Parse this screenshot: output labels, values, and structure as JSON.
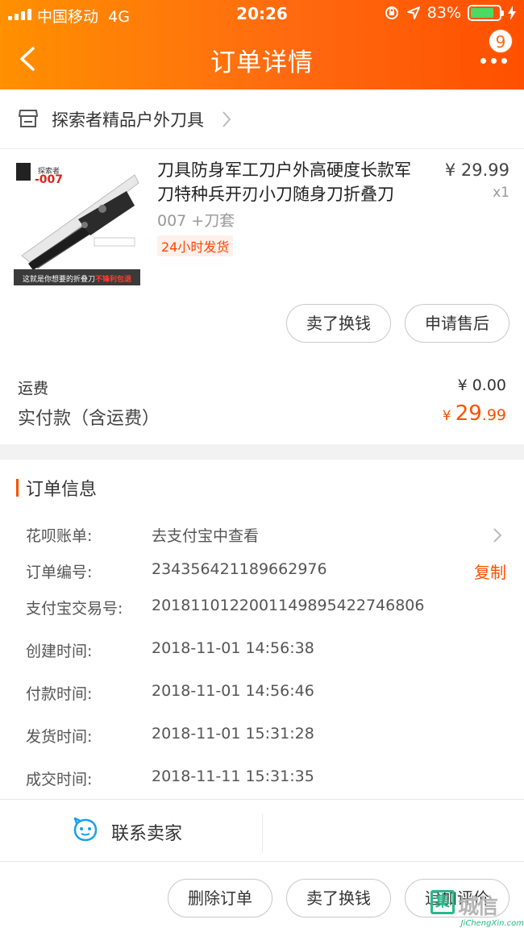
{
  "status_bar": {
    "carrier": "中国移动",
    "network": "4G",
    "time": "20:26",
    "battery_percent": "83%",
    "battery_level": 0.83
  },
  "nav": {
    "title": "订单详情",
    "badge": "9"
  },
  "shop": {
    "name": "探索者精品户外刀具"
  },
  "product": {
    "image": {
      "brand_label": "探索者",
      "model": "-007",
      "banner_prefix": "这就是你想要的折叠刀",
      "banner_highlight": "不锋利包退"
    },
    "title": "刀具防身军工刀户外高硬度长款军刀特种兵开刃小刀随身刀折叠刀",
    "price": "¥ 29.99",
    "quantity": "x1",
    "sku": "007 +刀套",
    "tag": "24小时发货"
  },
  "item_actions": {
    "resell": "卖了换钱",
    "after_sale": "申请售后"
  },
  "summary": {
    "shipping_label": "运费",
    "shipping_value": "¥ 0.00",
    "paid_label": "实付款（含运费）",
    "paid_currency": "¥",
    "paid_int": "29",
    "paid_dec": ".99"
  },
  "order_info": {
    "section_title": "订单信息",
    "huabei_label": "花呗账单:",
    "huabei_value": "去支付宝中查看",
    "order_no_label": "订单编号:",
    "order_no_value": "234356421189662976",
    "copy_label": "复制",
    "alipay_no_label": "支付宝交易号:",
    "alipay_no_value": "2018110122001149895422746806",
    "created_label": "创建时间:",
    "created_value": "2018-11-01 14:56:38",
    "paid_time_label": "付款时间:",
    "paid_time_value": "2018-11-01 14:56:46",
    "shipped_label": "发货时间:",
    "shipped_value": "2018-11-01 15:31:28",
    "completed_label": "成交时间:",
    "completed_value": "2018-11-11 15:31:35"
  },
  "contact": {
    "label": "联系卖家"
  },
  "bottom_actions": {
    "delete": "删除订单",
    "resell": "卖了换钱",
    "review": "追加评价"
  },
  "watermark": {
    "box_char": "集",
    "chars": "城信",
    "url": "JiChengXin.com"
  },
  "colors": {
    "header_start": "#ff9000",
    "header_end": "#ff5000",
    "accent": "#ff5000",
    "battery_green": "#4cd964",
    "contact_blue": "#1aa0e8",
    "watermark_green": "#27b98a"
  }
}
